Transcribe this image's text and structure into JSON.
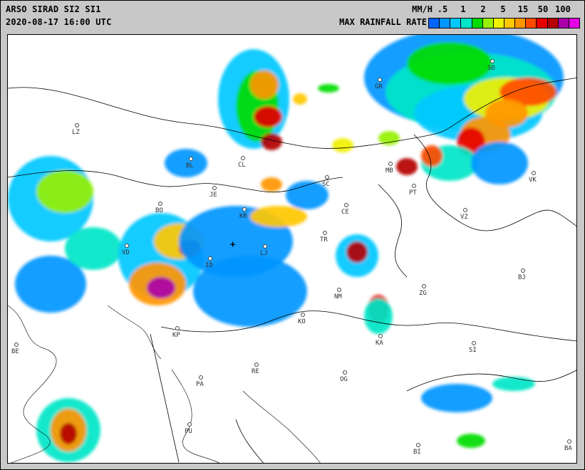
{
  "header": {
    "title": "ARSO SIRAD SI2 SI1",
    "timestamp": "2020-08-17 16:00 UTC"
  },
  "legend": {
    "units": "MM/H",
    "label": "MAX RAINFALL RATE",
    "ticks": [
      ".5",
      "1",
      "2",
      "5",
      "15",
      "50",
      "100"
    ],
    "colors": [
      "#0064ff",
      "#0096ff",
      "#00c8ff",
      "#00e6c8",
      "#00dc00",
      "#96f000",
      "#f0f000",
      "#ffc800",
      "#ff9600",
      "#ff4b00",
      "#e60000",
      "#b40000",
      "#aa00aa",
      "#e600e6"
    ]
  },
  "cities": [
    {
      "code": "LZ",
      "name": "city-lz"
    },
    {
      "code": "GR",
      "name": "city-gr"
    },
    {
      "code": "SO",
      "name": "city-so"
    },
    {
      "code": "BL",
      "name": "city-bl"
    },
    {
      "code": "CL",
      "name": "city-cl"
    },
    {
      "code": "JE",
      "name": "city-je"
    },
    {
      "code": "SC",
      "name": "city-sc"
    },
    {
      "code": "MB",
      "name": "city-mb"
    },
    {
      "code": "PT",
      "name": "city-pt"
    },
    {
      "code": "VK",
      "name": "city-vk"
    },
    {
      "code": "BO",
      "name": "city-bo"
    },
    {
      "code": "KR",
      "name": "city-kr"
    },
    {
      "code": "CE",
      "name": "city-ce"
    },
    {
      "code": "VZ",
      "name": "city-vz"
    },
    {
      "code": "VD",
      "name": "city-vd"
    },
    {
      "code": "ID",
      "name": "city-id"
    },
    {
      "code": "LJ",
      "name": "city-lj"
    },
    {
      "code": "TR",
      "name": "city-tr"
    },
    {
      "code": "BJ",
      "name": "city-bj"
    },
    {
      "code": "NM",
      "name": "city-nm"
    },
    {
      "code": "ZG",
      "name": "city-zg"
    },
    {
      "code": "KO",
      "name": "city-ko"
    },
    {
      "code": "KP",
      "name": "city-kp"
    },
    {
      "code": "KA",
      "name": "city-ka"
    },
    {
      "code": "SI",
      "name": "city-si"
    },
    {
      "code": "BE",
      "name": "city-be"
    },
    {
      "code": "RE",
      "name": "city-re"
    },
    {
      "code": "PA",
      "name": "city-pa"
    },
    {
      "code": "OG",
      "name": "city-og"
    },
    {
      "code": "PU",
      "name": "city-pu"
    },
    {
      "code": "BI",
      "name": "city-bi"
    },
    {
      "code": "BA",
      "name": "city-ba"
    }
  ]
}
